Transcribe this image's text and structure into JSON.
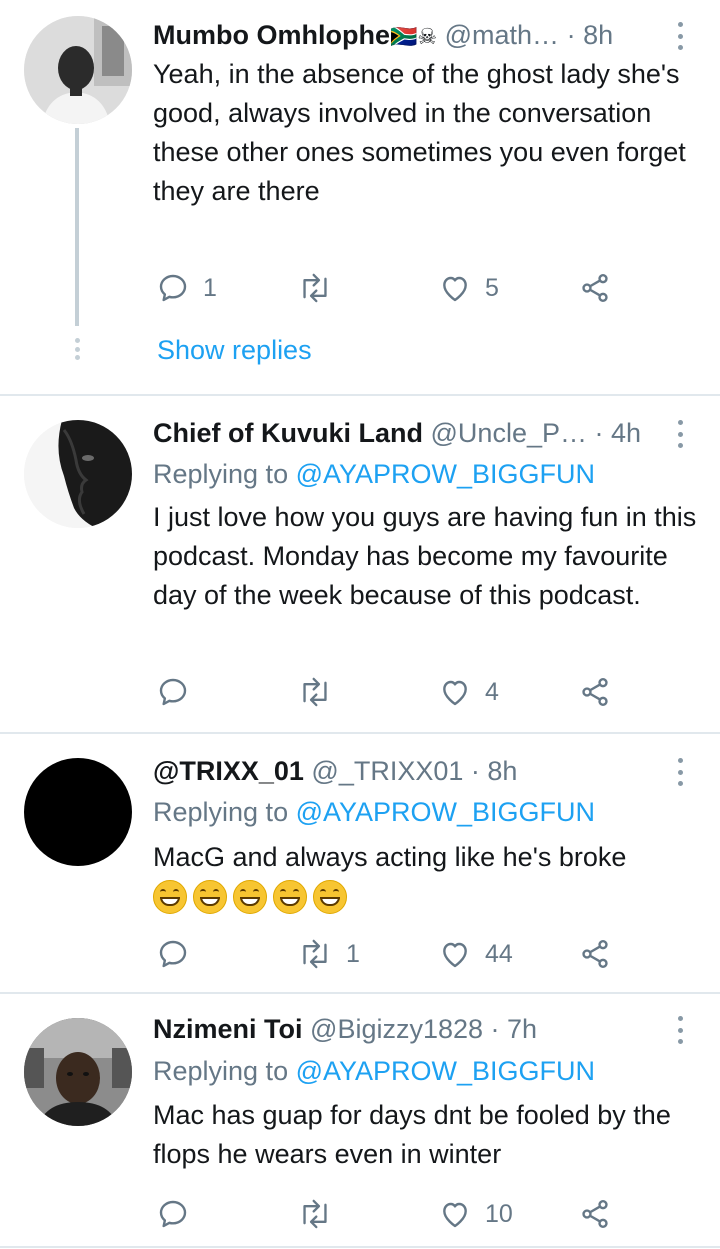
{
  "tweets": [
    {
      "name": "Mumbo Omhlophe",
      "name_emoji": "🇿🇦☠",
      "handle": "@math…",
      "time": "· 8h",
      "text": "Yeah, in the absence of the ghost lady she's good, always involved in the conversation these other ones sometimes you even forget they are there",
      "replies": "1",
      "retweets": "",
      "likes": "5",
      "show_replies": "Show replies",
      "avatar": "person-photo"
    },
    {
      "name": "Chief of Kuvuki Land",
      "handle": "@Uncle_P…",
      "time": "· 4h",
      "replying_prefix": "Replying to",
      "replying_handle": "@AYAPROW_BIGGFUN",
      "text": "I just love how you guys are having fun in this podcast. Monday has become my favourite day of the week because of this podcast.",
      "replies": "",
      "retweets": "",
      "likes": "4",
      "avatar": "face-silhouette-photo"
    },
    {
      "name": "@TRIXX_01",
      "handle": "@_TRIXX01",
      "time": "· 8h",
      "replying_prefix": "Replying to",
      "replying_handle": "@AYAPROW_BIGGFUN",
      "text": "MacG and always acting like he's broke",
      "emoji_count": "5",
      "replies": "",
      "retweets": "1",
      "likes": "44",
      "avatar": "black-circle"
    },
    {
      "name": "Nzimeni Toi",
      "handle": "@Bigizzy1828",
      "time": "· 7h",
      "replying_prefix": "Replying to",
      "replying_handle": "@AYAPROW_BIGGFUN",
      "text": "Mac has guap for days dnt be fooled by the flops he wears even in winter",
      "replies": "",
      "retweets": "",
      "likes": "10",
      "avatar": "car-selfie-photo"
    }
  ],
  "colors": {
    "accent": "#1da1f2",
    "muted": "#657786",
    "divider": "#e1e8ed"
  }
}
